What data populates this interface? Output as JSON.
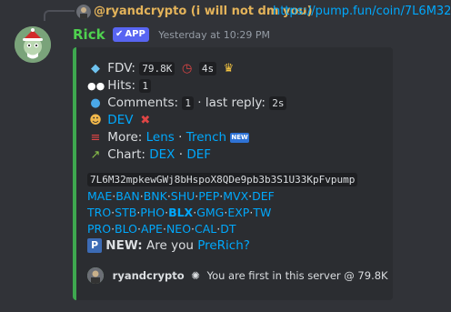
{
  "reply": {
    "author": "@ryandcrypto (i will not dm you)",
    "link": "https://pump.fun/coin/7L6M32"
  },
  "message": {
    "author": "Rick",
    "app_badge": "APP",
    "timestamp": "Yesterday at 10:29 PM"
  },
  "embed": {
    "accent_color": "#3ea84f",
    "fdv_label": "FDV:",
    "fdv_value": "79.8K",
    "fdv_age": "4s",
    "hits_label": "Hits:",
    "hits_value": "1",
    "comments_label": "Comments:",
    "comments_value": "1",
    "last_reply_label": "· last reply:",
    "last_reply_value": "2s",
    "dev_label": "DEV",
    "more_label": "More:",
    "more_links": [
      "Lens",
      "Trench"
    ],
    "chart_label": "Chart:",
    "chart_links": [
      "DEX",
      "DEF"
    ],
    "contract": "7L6M32mpkewGWj8bHspoX8QDe9pb3b3S1U33KpFvpump",
    "links_row1": [
      "MAE",
      "BAN",
      "BNK",
      "SHU",
      "PEP",
      "MVX",
      "DEF"
    ],
    "links_row2": [
      "TRO",
      "STB",
      "PHO",
      "BLX",
      "GMG",
      "EXP",
      "TW"
    ],
    "links_row3": [
      "PRO",
      "BLO",
      "APE",
      "NEO",
      "CAL",
      "DT"
    ],
    "new_label": "NEW:",
    "new_text": "Are you",
    "new_link": "PreRich?",
    "footer_author": "ryandcrypto",
    "footer_text": "You are first in this server @ 79.8K"
  }
}
